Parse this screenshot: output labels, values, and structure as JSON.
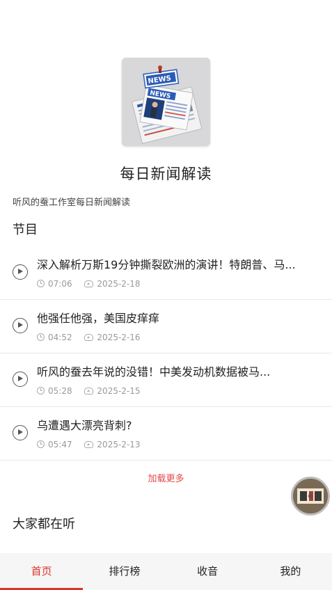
{
  "podcast": {
    "title": "每日新闻解读",
    "description": "听风的蚕工作室每日新闻解读",
    "cover_icon": "news-newspaper-cover"
  },
  "episodes_section": {
    "title": "节目",
    "items": [
      {
        "title": "深入解析万斯19分钟撕裂欧洲的演讲！特朗普、马...",
        "duration": "07:06",
        "date": "2025-2-18"
      },
      {
        "title": "他强任他强，美国皮痒痒",
        "duration": "04:52",
        "date": "2025-2-16"
      },
      {
        "title": "听风的蚕去年说的没错！中美发动机数据被马...",
        "duration": "05:28",
        "date": "2025-2-15"
      },
      {
        "title": "乌遭遇大漂亮背刺?",
        "duration": "05:47",
        "date": "2025-2-13"
      }
    ],
    "load_more": "加载更多"
  },
  "popular_section": {
    "title": "大家都在听"
  },
  "tabbar": {
    "tabs": [
      {
        "label": "首页",
        "active": true
      },
      {
        "label": "排行榜",
        "active": false
      },
      {
        "label": "收音",
        "active": false
      },
      {
        "label": "我的",
        "active": false
      }
    ]
  },
  "colors": {
    "accent": "#d9352b",
    "load_more": "#e24848",
    "meta": "#999999"
  }
}
